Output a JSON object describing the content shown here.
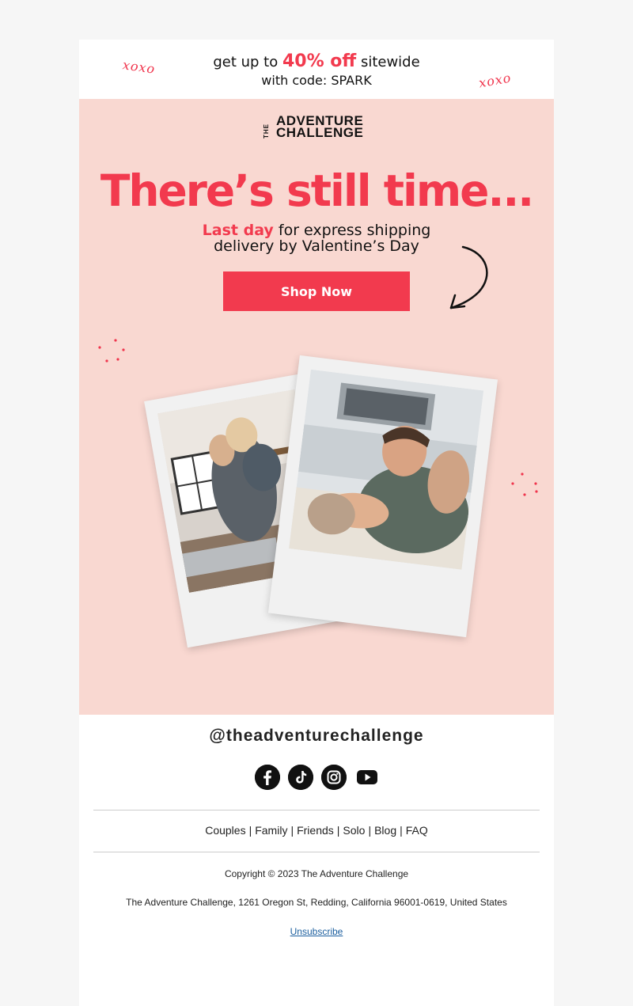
{
  "promo": {
    "prefix": "get up to",
    "highlight": "40% off",
    "suffix": "sitewide",
    "code_line": "with code: SPARK",
    "xoxo_left": "xoxo",
    "xoxo_right": "xoxo"
  },
  "brand": {
    "the": "THE",
    "line1": "ADVENTURE",
    "line2": "CHALLENGE"
  },
  "hero": {
    "headline": "There’s still time...",
    "sub_accent": "Last day",
    "sub_rest": "for express shipping",
    "sub_line2": "delivery by Valentine’s Day",
    "cta_label": "Shop Now"
  },
  "social": {
    "handle": "@theadventurechallenge",
    "icons": [
      "facebook-icon",
      "tiktok-icon",
      "instagram-icon",
      "youtube-icon"
    ]
  },
  "footer": {
    "links": [
      "Couples",
      "Family",
      "Friends",
      "Solo",
      "Blog",
      "FAQ"
    ],
    "separator": "|",
    "copyright": "Copyright © 2023 The Adventure Challenge",
    "address": "The Adventure Challenge, 1261 Oregon St, Redding, California 96001-0619, United States",
    "unsubscribe": "Unsubscribe"
  },
  "colors": {
    "accent": "#f23a4e",
    "hero_bg": "#f9d8d1",
    "page_bg": "#f6f6f6"
  }
}
